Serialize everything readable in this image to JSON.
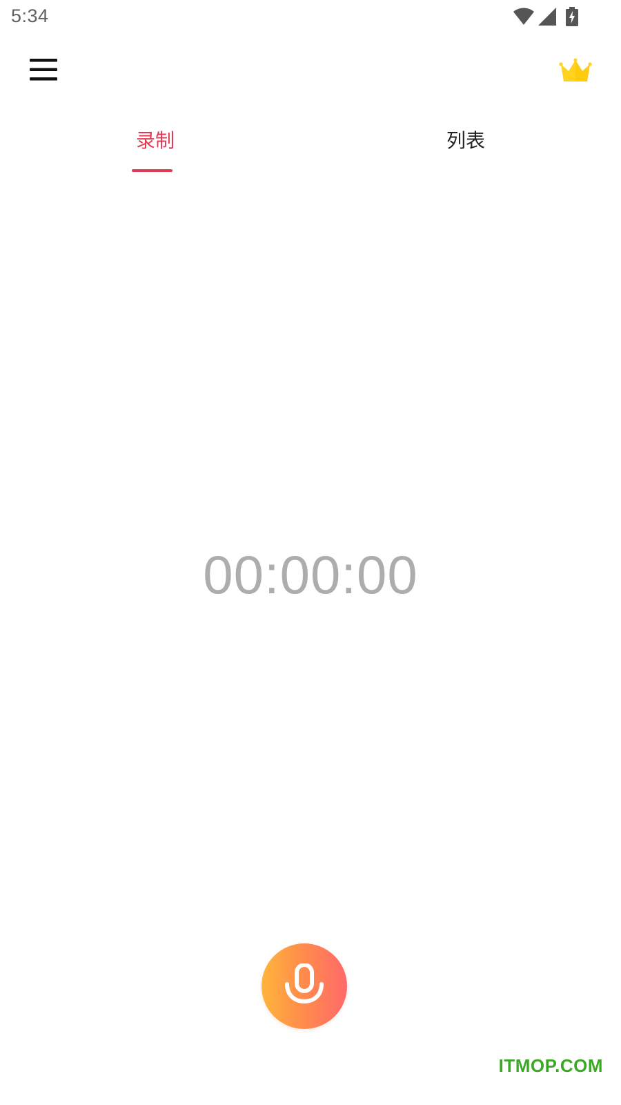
{
  "status_bar": {
    "time": "5:34",
    "icons": [
      "wifi-icon",
      "cellular-signal-icon",
      "battery-charging-icon"
    ],
    "icon_color": "#555555"
  },
  "app_bar": {
    "menu_icon": "hamburger-menu-icon",
    "premium_icon": "crown-icon",
    "crown_color": "#ffd21e"
  },
  "tabs": [
    {
      "label": "录制",
      "selected": true
    },
    {
      "label": "列表",
      "selected": false
    }
  ],
  "accent_color": "#e23a55",
  "timer": {
    "value": "00:00:00",
    "color": "#adadad"
  },
  "record_button": {
    "icon": "microphone-icon",
    "gradient": [
      "#ffb43c",
      "#ff6a6a"
    ]
  },
  "watermark": {
    "text": "ITMOP.COM",
    "color": "#3ca826"
  }
}
